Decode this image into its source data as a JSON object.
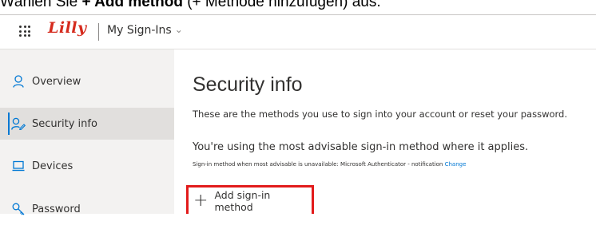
{
  "caption": {
    "prefix": "Wählen Sie ",
    "bold": "+ Add method",
    "suffix": " (+ Methode hinzufügen) aus."
  },
  "header": {
    "logo": "Lilly",
    "app_title": "My Sign-Ins",
    "brand_color": "#d52b1e"
  },
  "sidebar": {
    "items": [
      {
        "label": "Overview",
        "icon": "person-icon"
      },
      {
        "label": "Security info",
        "icon": "security-info-icon",
        "active": true
      },
      {
        "label": "Devices",
        "icon": "laptop-icon"
      },
      {
        "label": "Password",
        "icon": "key-icon"
      }
    ]
  },
  "main": {
    "title": "Security info",
    "subtitle": "These are the methods you use to sign into your account or reset your password.",
    "advisable": "You're using the most advisable sign-in method where it applies.",
    "fallback_text": "Sign-in method when most advisable is unavailable: Microsoft Authenticator - notification",
    "change_link": "Change",
    "add_method": "Add sign-in method",
    "accent_color": "#0078d4",
    "highlight_color": "#e21b1b"
  }
}
